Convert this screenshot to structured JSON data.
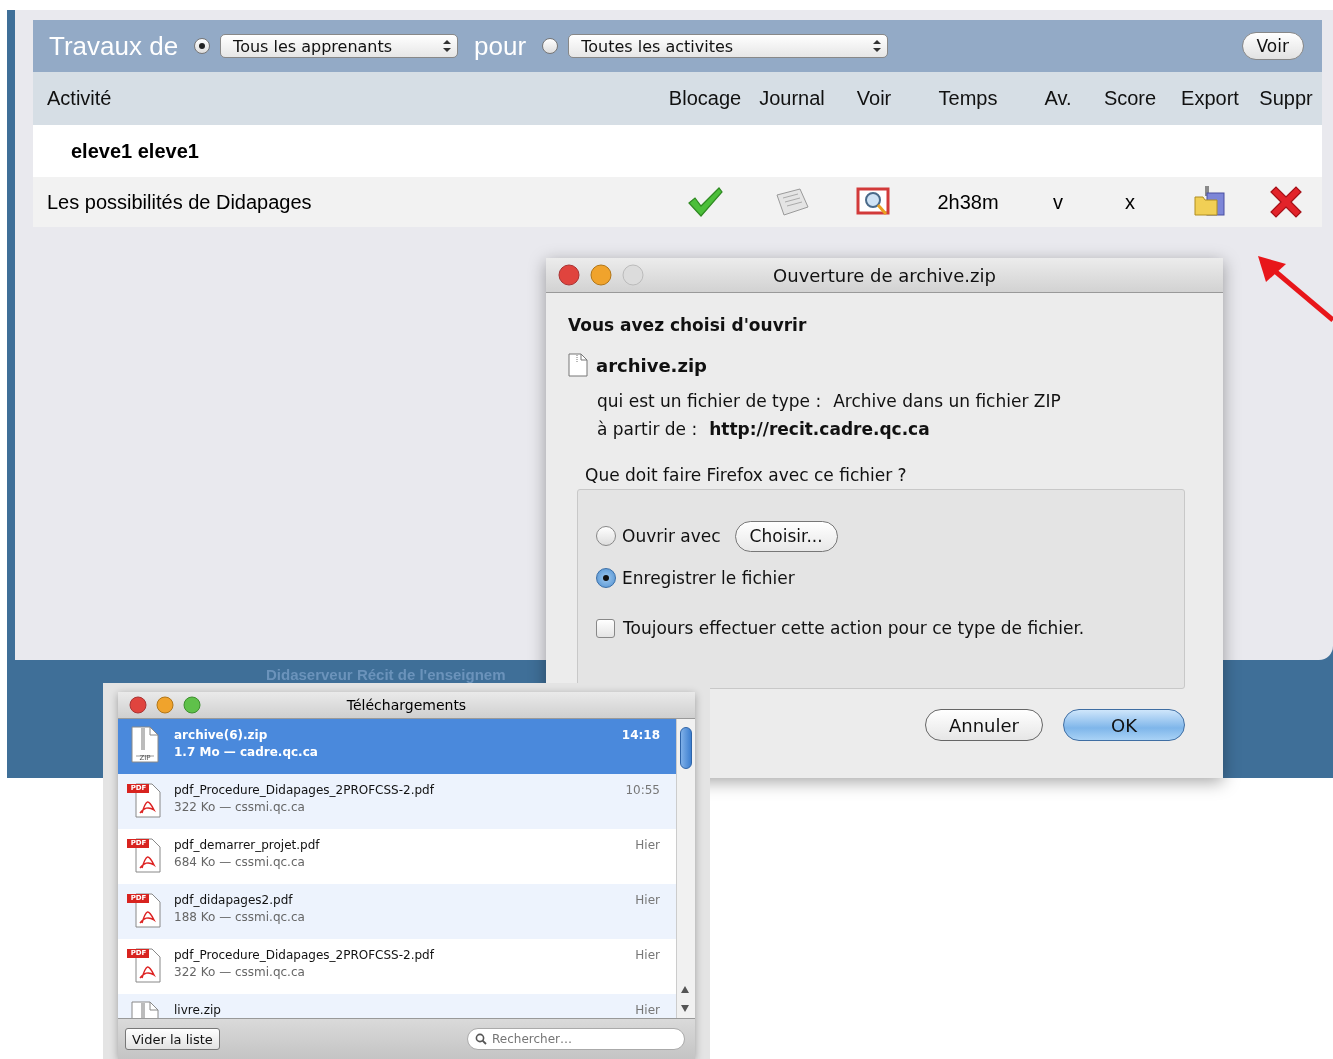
{
  "header": {
    "title": "Travaux de",
    "learner_filter": {
      "selected": true,
      "value": "Tous les apprenants"
    },
    "connector": "pour",
    "activity_filter": {
      "selected": false,
      "value": "Toutes les activites"
    },
    "view_button": "Voir"
  },
  "table": {
    "columns": [
      "Activité",
      "Blocage",
      "Journal",
      "Voir",
      "Temps",
      "Av.",
      "Score",
      "Export",
      "Suppr"
    ],
    "groups": [
      {
        "student": "eleve1 eleve1",
        "rows": [
          {
            "activity": "Les possibilités de Didapages",
            "unlocked": true,
            "time": "2h38m",
            "av": "v",
            "score": "x"
          }
        ]
      }
    ]
  },
  "footer": "Didaserveur Récit de l'enseignem",
  "dialog": {
    "title": "Ouverture de archive.zip",
    "heading": "Vous avez choisi d'ouvrir",
    "file": "archive.zip",
    "type_label": "qui est un fichier de type :",
    "type_value": "Archive dans un fichier ZIP",
    "source_label": "à partir de :",
    "source_value": "http://recit.cadre.qc.ca",
    "question": "Que doit faire Firefox avec ce fichier ?",
    "options": [
      {
        "label": "Ouvrir avec",
        "selected": false,
        "button": "Choisir..."
      },
      {
        "label": "Enregistrer le fichier",
        "selected": true
      }
    ],
    "remember": {
      "label": "Toujours effectuer cette action pour ce type de fichier.",
      "checked": false
    },
    "buttons": [
      {
        "label": "Annuler",
        "default": false
      },
      {
        "label": "OK",
        "default": true
      }
    ]
  },
  "downloads": {
    "title": "Téléchargements",
    "items": [
      {
        "kind": "zip",
        "icon_label": "ZIP",
        "name": "archive(6).zip",
        "meta": "1.7 Mo — cadre.qc.ca",
        "time": "14:18",
        "selected": true
      },
      {
        "kind": "pdf",
        "icon_label": "PDF",
        "name": "pdf_Procedure_Didapages_2PROFCSS-2.pdf",
        "meta": "322 Ko — cssmi.qc.ca",
        "time": "10:55",
        "selected": false
      },
      {
        "kind": "pdf",
        "icon_label": "PDF",
        "name": "pdf_demarrer_projet.pdf",
        "meta": "684 Ko — cssmi.qc.ca",
        "time": "Hier",
        "selected": false
      },
      {
        "kind": "pdf",
        "icon_label": "PDF",
        "name": "pdf_didapages2.pdf",
        "meta": "188 Ko — cssmi.qc.ca",
        "time": "Hier",
        "selected": false
      },
      {
        "kind": "pdf",
        "icon_label": "PDF",
        "name": "pdf_Procedure_Didapages_2PROFCSS-2.pdf",
        "meta": "322 Ko — cssmi.qc.ca",
        "time": "Hier",
        "selected": false
      },
      {
        "kind": "zip",
        "name": "livre.zip",
        "time": "Hier",
        "selected": false
      }
    ],
    "clear_button": "Vider la liste",
    "search": {
      "placeholder": "Rechercher…"
    }
  }
}
